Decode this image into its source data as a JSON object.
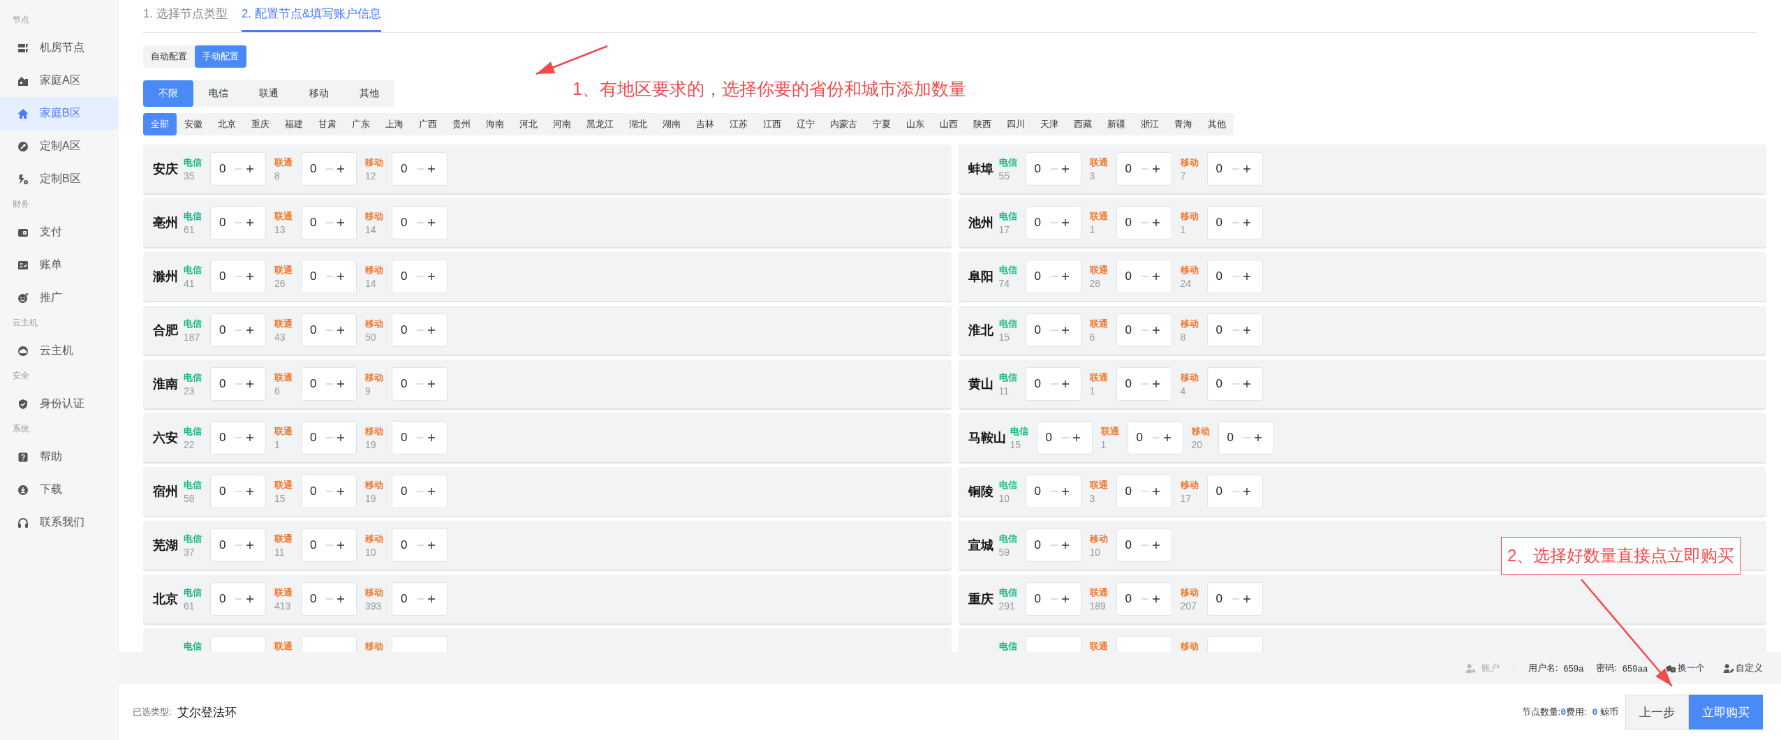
{
  "sidebar": {
    "sections": [
      {
        "title": "节点",
        "items": [
          {
            "label": "机房节点",
            "kind": "server",
            "selected": false
          },
          {
            "label": "家庭A区",
            "kind": "building",
            "selected": false
          },
          {
            "label": "家庭B区",
            "kind": "home",
            "selected": true
          },
          {
            "label": "定制A区",
            "kind": "wrench",
            "selected": false
          },
          {
            "label": "定制B区",
            "kind": "bolt",
            "selected": false
          }
        ]
      },
      {
        "title": "财务",
        "items": [
          {
            "label": "支付",
            "kind": "wallet",
            "selected": false
          },
          {
            "label": "账单",
            "kind": "bill",
            "selected": false
          },
          {
            "label": "推广",
            "kind": "smile",
            "selected": false
          }
        ]
      },
      {
        "title": "云主机",
        "items": [
          {
            "label": "云主机",
            "kind": "cloud",
            "selected": false
          }
        ]
      },
      {
        "title": "安全",
        "items": [
          {
            "label": "身份认证",
            "kind": "shield",
            "selected": false
          }
        ]
      },
      {
        "title": "系统",
        "items": [
          {
            "label": "帮助",
            "kind": "help",
            "selected": false
          },
          {
            "label": "下载",
            "kind": "download",
            "selected": false
          },
          {
            "label": "联系我们",
            "kind": "headset",
            "selected": false
          }
        ]
      }
    ]
  },
  "steps": [
    {
      "label": "1. 选择节点类型",
      "selected": false
    },
    {
      "label": "2. 配置节点&填写账户信息",
      "selected": true
    }
  ],
  "config_modes": [
    {
      "label": "自动配置",
      "selected": false
    },
    {
      "label": "手动配置",
      "selected": true
    }
  ],
  "carrier_filter": [
    {
      "label": "不限",
      "selected": true
    },
    {
      "label": "电信",
      "selected": false
    },
    {
      "label": "联通",
      "selected": false
    },
    {
      "label": "移动",
      "selected": false
    },
    {
      "label": "其他",
      "selected": false
    }
  ],
  "provinces": [
    {
      "label": "全部",
      "selected": true
    },
    {
      "label": "安徽",
      "selected": false
    },
    {
      "label": "北京",
      "selected": false
    },
    {
      "label": "重庆",
      "selected": false
    },
    {
      "label": "福建",
      "selected": false
    },
    {
      "label": "甘肃",
      "selected": false
    },
    {
      "label": "广东",
      "selected": false
    },
    {
      "label": "上海",
      "selected": false
    },
    {
      "label": "广西",
      "selected": false
    },
    {
      "label": "贵州",
      "selected": false
    },
    {
      "label": "海南",
      "selected": false
    },
    {
      "label": "河北",
      "selected": false
    },
    {
      "label": "河南",
      "selected": false
    },
    {
      "label": "黑龙江",
      "selected": false
    },
    {
      "label": "湖北",
      "selected": false
    },
    {
      "label": "湖南",
      "selected": false
    },
    {
      "label": "吉林",
      "selected": false
    },
    {
      "label": "江苏",
      "selected": false
    },
    {
      "label": "江西",
      "selected": false
    },
    {
      "label": "辽宁",
      "selected": false
    },
    {
      "label": "内蒙古",
      "selected": false
    },
    {
      "label": "宁夏",
      "selected": false
    },
    {
      "label": "山东",
      "selected": false
    },
    {
      "label": "山西",
      "selected": false
    },
    {
      "label": "陕西",
      "selected": false
    },
    {
      "label": "四川",
      "selected": false
    },
    {
      "label": "天津",
      "selected": false
    },
    {
      "label": "西藏",
      "selected": false
    },
    {
      "label": "新疆",
      "selected": false
    },
    {
      "label": "浙江",
      "selected": false
    },
    {
      "label": "青海",
      "selected": false
    },
    {
      "label": "其他",
      "selected": false
    }
  ],
  "cities": [
    {
      "city": "安庆",
      "carriers": [
        {
          "kind": "telecom",
          "label": "电信",
          "count": "35",
          "value": "0"
        },
        {
          "kind": "unicom",
          "label": "联通",
          "count": "8",
          "value": "0"
        },
        {
          "kind": "mobile",
          "label": "移动",
          "count": "12",
          "value": "0"
        }
      ]
    },
    {
      "city": "蚌埠",
      "carriers": [
        {
          "kind": "telecom",
          "label": "电信",
          "count": "55",
          "value": "0"
        },
        {
          "kind": "unicom",
          "label": "联通",
          "count": "3",
          "value": "0"
        },
        {
          "kind": "mobile",
          "label": "移动",
          "count": "7",
          "value": "0"
        }
      ]
    },
    {
      "city": "亳州",
      "carriers": [
        {
          "kind": "telecom",
          "label": "电信",
          "count": "61",
          "value": "0"
        },
        {
          "kind": "unicom",
          "label": "联通",
          "count": "13",
          "value": "0"
        },
        {
          "kind": "mobile",
          "label": "移动",
          "count": "14",
          "value": "0"
        }
      ]
    },
    {
      "city": "池州",
      "carriers": [
        {
          "kind": "telecom",
          "label": "电信",
          "count": "17",
          "value": "0"
        },
        {
          "kind": "unicom",
          "label": "联通",
          "count": "1",
          "value": "0"
        },
        {
          "kind": "mobile",
          "label": "移动",
          "count": "1",
          "value": "0"
        }
      ]
    },
    {
      "city": "滁州",
      "carriers": [
        {
          "kind": "telecom",
          "label": "电信",
          "count": "41",
          "value": "0"
        },
        {
          "kind": "unicom",
          "label": "联通",
          "count": "26",
          "value": "0"
        },
        {
          "kind": "mobile",
          "label": "移动",
          "count": "14",
          "value": "0"
        }
      ]
    },
    {
      "city": "阜阳",
      "carriers": [
        {
          "kind": "telecom",
          "label": "电信",
          "count": "74",
          "value": "0"
        },
        {
          "kind": "unicom",
          "label": "联通",
          "count": "28",
          "value": "0"
        },
        {
          "kind": "mobile",
          "label": "移动",
          "count": "24",
          "value": "0"
        }
      ]
    },
    {
      "city": "合肥",
      "carriers": [
        {
          "kind": "telecom",
          "label": "电信",
          "count": "187",
          "value": "0"
        },
        {
          "kind": "unicom",
          "label": "联通",
          "count": "43",
          "value": "0"
        },
        {
          "kind": "mobile",
          "label": "移动",
          "count": "50",
          "value": "0"
        }
      ]
    },
    {
      "city": "淮北",
      "carriers": [
        {
          "kind": "telecom",
          "label": "电信",
          "count": "15",
          "value": "0"
        },
        {
          "kind": "unicom",
          "label": "联通",
          "count": "6",
          "value": "0"
        },
        {
          "kind": "mobile",
          "label": "移动",
          "count": "8",
          "value": "0"
        }
      ]
    },
    {
      "city": "淮南",
      "carriers": [
        {
          "kind": "telecom",
          "label": "电信",
          "count": "23",
          "value": "0"
        },
        {
          "kind": "unicom",
          "label": "联通",
          "count": "6",
          "value": "0"
        },
        {
          "kind": "mobile",
          "label": "移动",
          "count": "9",
          "value": "0"
        }
      ]
    },
    {
      "city": "黄山",
      "carriers": [
        {
          "kind": "telecom",
          "label": "电信",
          "count": "11",
          "value": "0"
        },
        {
          "kind": "unicom",
          "label": "联通",
          "count": "1",
          "value": "0"
        },
        {
          "kind": "mobile",
          "label": "移动",
          "count": "4",
          "value": "0"
        }
      ]
    },
    {
      "city": "六安",
      "carriers": [
        {
          "kind": "telecom",
          "label": "电信",
          "count": "22",
          "value": "0"
        },
        {
          "kind": "unicom",
          "label": "联通",
          "count": "1",
          "value": "0"
        },
        {
          "kind": "mobile",
          "label": "移动",
          "count": "19",
          "value": "0"
        }
      ]
    },
    {
      "city": "马鞍山",
      "carriers": [
        {
          "kind": "telecom",
          "label": "电信",
          "count": "15",
          "value": "0"
        },
        {
          "kind": "unicom",
          "label": "联通",
          "count": "1",
          "value": "0"
        },
        {
          "kind": "mobile",
          "label": "移动",
          "count": "20",
          "value": "0"
        }
      ]
    },
    {
      "city": "宿州",
      "carriers": [
        {
          "kind": "telecom",
          "label": "电信",
          "count": "58",
          "value": "0"
        },
        {
          "kind": "unicom",
          "label": "联通",
          "count": "15",
          "value": "0"
        },
        {
          "kind": "mobile",
          "label": "移动",
          "count": "19",
          "value": "0"
        }
      ]
    },
    {
      "city": "铜陵",
      "carriers": [
        {
          "kind": "telecom",
          "label": "电信",
          "count": "10",
          "value": "0"
        },
        {
          "kind": "unicom",
          "label": "联通",
          "count": "3",
          "value": "0"
        },
        {
          "kind": "mobile",
          "label": "移动",
          "count": "17",
          "value": "0"
        }
      ]
    },
    {
      "city": "芜湖",
      "carriers": [
        {
          "kind": "telecom",
          "label": "电信",
          "count": "37",
          "value": "0"
        },
        {
          "kind": "unicom",
          "label": "联通",
          "count": "11",
          "value": "0"
        },
        {
          "kind": "mobile",
          "label": "移动",
          "count": "10",
          "value": "0"
        }
      ]
    },
    {
      "city": "宣城",
      "carriers": [
        {
          "kind": "telecom",
          "label": "电信",
          "count": "59",
          "value": "0"
        },
        {
          "kind": "mobile",
          "label": "移动",
          "count": "10",
          "value": "0"
        }
      ]
    },
    {
      "city": "北京",
      "carriers": [
        {
          "kind": "telecom",
          "label": "电信",
          "count": "61",
          "value": "0"
        },
        {
          "kind": "unicom",
          "label": "联通",
          "count": "413",
          "value": "0"
        },
        {
          "kind": "mobile",
          "label": "移动",
          "count": "393",
          "value": "0"
        }
      ]
    },
    {
      "city": "重庆",
      "carriers": [
        {
          "kind": "telecom",
          "label": "电信",
          "count": "291",
          "value": "0"
        },
        {
          "kind": "unicom",
          "label": "联通",
          "count": "189",
          "value": "0"
        },
        {
          "kind": "mobile",
          "label": "移动",
          "count": "207",
          "value": "0"
        }
      ]
    },
    {
      "carriers": [
        {
          "kind": "telecom",
          "label": "电信"
        },
        {
          "kind": "unicom",
          "label": "联通"
        },
        {
          "kind": "mobile",
          "label": "移动"
        }
      ]
    },
    {
      "carriers": [
        {
          "kind": "telecom",
          "label": "电信"
        },
        {
          "kind": "unicom",
          "label": "联通"
        },
        {
          "kind": "mobile",
          "label": "移动"
        }
      ]
    }
  ],
  "account_bar": {
    "account_label": "账户",
    "username_label": "用户名:",
    "username": "659a",
    "password_label": "密码:",
    "password": "659aa",
    "regenerate": "换一个",
    "custom": "自定义"
  },
  "footer": {
    "selected_type_label": "已选类型:",
    "selected_type": "艾尔登法环",
    "node_count_label": "节点数量:",
    "node_count": "0",
    "fee_label": "费用:",
    "fee": "0",
    "currency": "鲸币",
    "back_button": "上一步",
    "buy_button": "立即购买"
  },
  "annotations": [
    {
      "text": "1、有地区要求的，选择你要的省份和城市添加数量",
      "boxed": false
    },
    {
      "text": "2、选择好数量直接点立即购买",
      "boxed": true
    }
  ]
}
